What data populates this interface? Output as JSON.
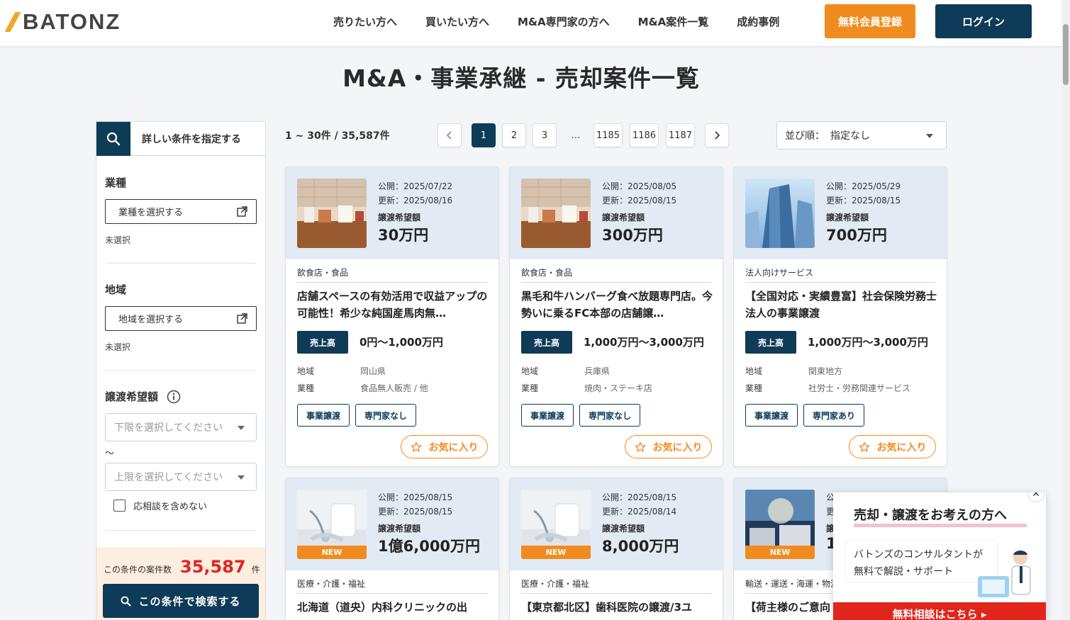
{
  "header": {
    "logo_text": "BATONZ",
    "nav": [
      "売りたい方へ",
      "買いたい方へ",
      "M&A専門家の方へ",
      "M&A案件一覧",
      "成約事例"
    ],
    "register_label": "無料会員登録",
    "login_label": "ログイン"
  },
  "page_title": "M&A・事業承継 - 売却案件一覧",
  "sidebar": {
    "header_label": "詳しい条件を指定する",
    "industry_label": "業種",
    "industry_select": "業種を選択する",
    "industry_status": "未選択",
    "region_label": "地域",
    "region_select": "地域を選択する",
    "region_status": "未選択",
    "price_label": "譲渡希望額",
    "min_placeholder": "下限を選択してください",
    "tilde": "〜",
    "max_placeholder": "上限を選択してください",
    "checkbox_label": "応相談を含めない",
    "count_label": "この条件の案件数",
    "count_value": "35,587",
    "count_unit": "件",
    "search_label": "この条件で検索する"
  },
  "results": {
    "range_text": "1 ~ 30件 / 35,587件"
  },
  "pagination": {
    "pages": [
      "1",
      "2",
      "3",
      "…",
      "1185",
      "1186",
      "1187"
    ],
    "active": "1"
  },
  "sort": {
    "label": "並び順：",
    "value": "指定なし"
  },
  "cards": [
    {
      "published": "公開：2025/07/22",
      "updated": "更新：2025/08/16",
      "price_label": "譲渡希望額",
      "price": "30万円",
      "category": "飲食店・食品",
      "title": "店舗スペースの有効活用で収益アップの可能性！希少な純国産馬肉無…",
      "revenue_tag": "売上高",
      "revenue": "0円〜1,000万円",
      "region_key": "地域",
      "region": "岡山県",
      "industry_key": "業種",
      "industry": "食品無人販売 / 他",
      "badge1": "事業譲渡",
      "badge2": "専門家なし",
      "fav": "お気に入り",
      "new": ""
    },
    {
      "published": "公開：2025/08/05",
      "updated": "更新：2025/08/15",
      "price_label": "譲渡希望額",
      "price": "300万円",
      "category": "飲食店・食品",
      "title": "黒毛和牛ハンバーグ食べ放題専門店。今勢いに乗るFC本部の店舗譲…",
      "revenue_tag": "売上高",
      "revenue": "1,000万円〜3,000万円",
      "region_key": "地域",
      "region": "兵庫県",
      "industry_key": "業種",
      "industry": "焼肉・ステーキ店",
      "badge1": "事業譲渡",
      "badge2": "専門家なし",
      "fav": "お気に入り",
      "new": ""
    },
    {
      "published": "公開：2025/05/29",
      "updated": "更新：2025/08/15",
      "price_label": "譲渡希望額",
      "price": "700万円",
      "category": "法人向けサービス",
      "title": "【全国対応・実績豊富】社会保険労務士法人の事業譲渡",
      "revenue_tag": "売上高",
      "revenue": "1,000万円〜3,000万円",
      "region_key": "地域",
      "region": "関東地方",
      "industry_key": "業種",
      "industry": "社労士・労務関連サービス",
      "badge1": "事業譲渡",
      "badge2": "専門家あり",
      "fav": "お気に入り",
      "new": ""
    },
    {
      "published": "公開：2025/08/15",
      "updated": "更新：2025/08/15",
      "price_label": "譲渡希望額",
      "price": "1億6,000万円",
      "category": "医療・介護・福祉",
      "title": "北海道（道央）内科クリニックの出",
      "new": "NEW"
    },
    {
      "published": "公開：2025/08/15",
      "updated": "更新：2025/08/14",
      "price_label": "譲渡希望額",
      "price": "8,000万円",
      "category": "医療・介護・福祉",
      "title": "【東京都北区】歯科医院の譲渡/3ユ",
      "new": "NEW"
    },
    {
      "published": "公",
      "updated": "更",
      "price_label": "譲",
      "price": "1",
      "category": "輸送・運送・海運・物流",
      "title": "【荷主様のご意向",
      "new": "NEW"
    }
  ],
  "popup": {
    "title": "売却・譲渡をお考えの方へ",
    "body_line1": "バトンズのコンサルタントが",
    "body_line2": "無料で解説・サポート",
    "cta": "無料相談はこちら ▸"
  },
  "colors": {
    "navy": "#0e3b57",
    "orange": "#f08c1f",
    "red": "#e02424"
  }
}
